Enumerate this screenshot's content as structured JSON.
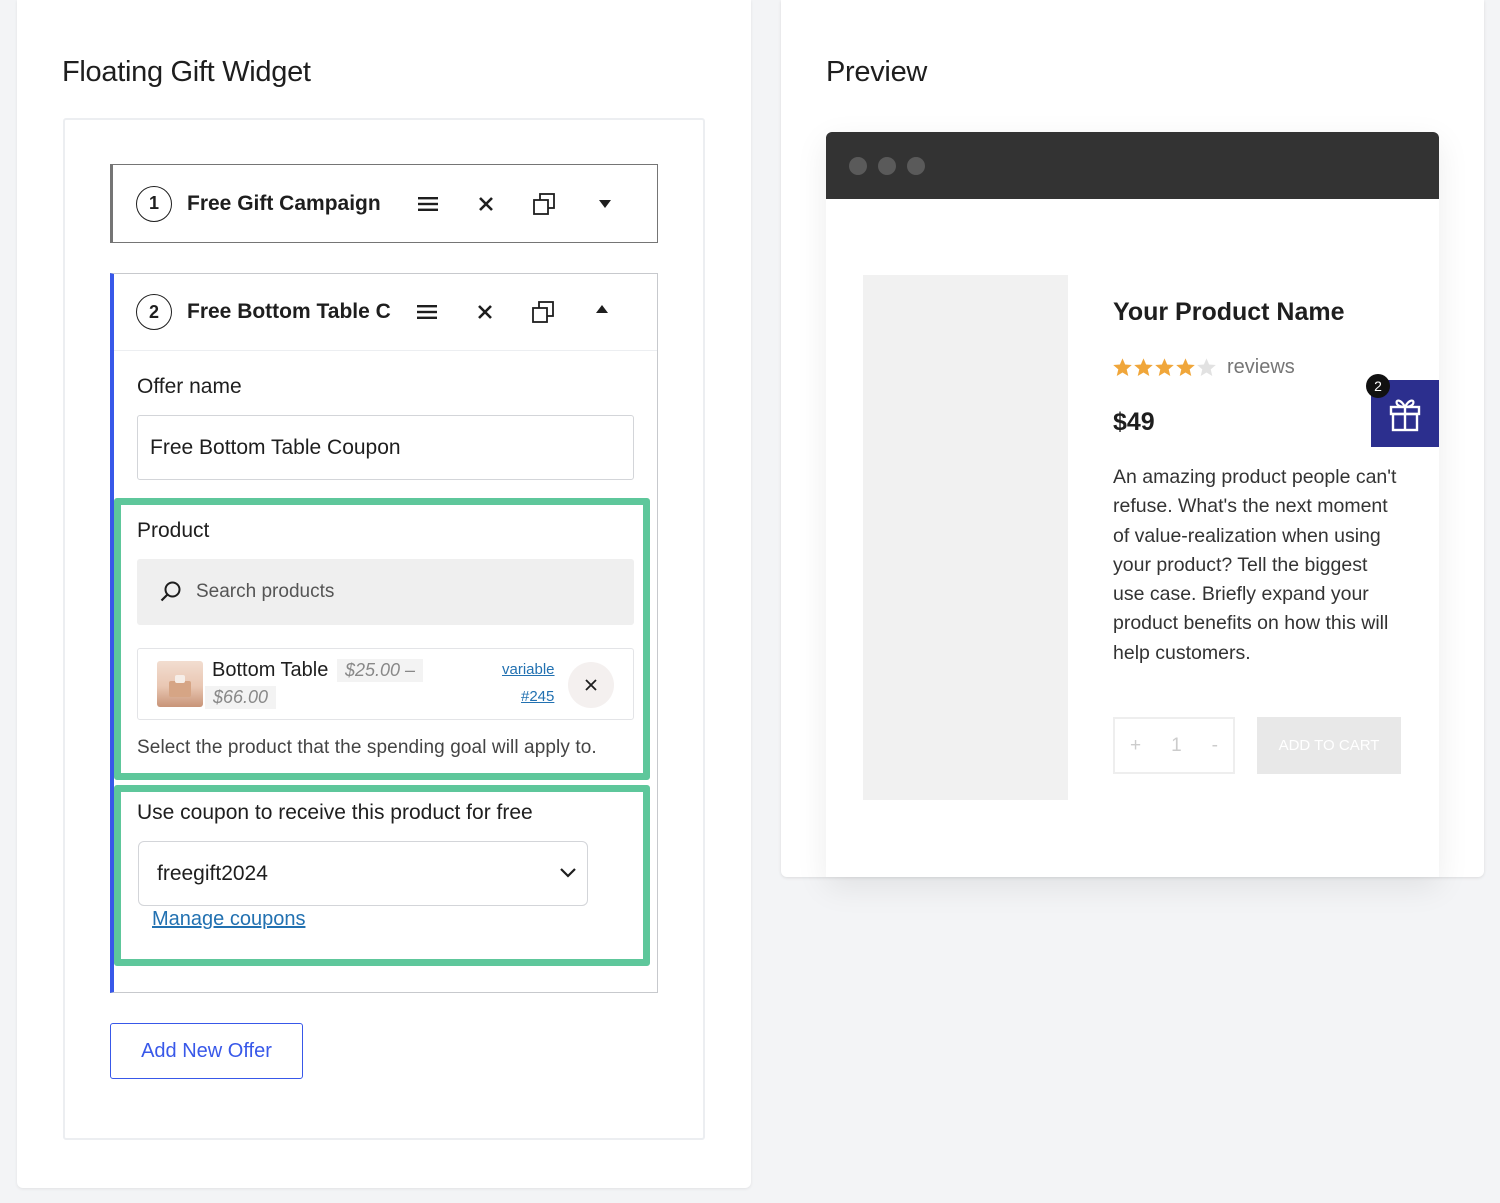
{
  "left_panel": {
    "title": "Floating Gift Widget"
  },
  "right_panel": {
    "title": "Preview"
  },
  "offers": [
    {
      "number": "1",
      "name": "Free Gift Campaign",
      "expanded": false
    },
    {
      "number": "2",
      "name": "Free Bottom Table C",
      "expanded": true
    }
  ],
  "offer_form": {
    "offer_name_label": "Offer name",
    "offer_name_value": "Free Bottom Table Coupon",
    "product_label": "Product",
    "search_placeholder": "Search products",
    "selected_product": {
      "name": "Bottom Table",
      "price_range_start": "$25.00 –",
      "price_range_end": "$66.00",
      "type": "variable",
      "id": "#245"
    },
    "product_help": "Select the product that the spending goal will apply to.",
    "coupon_label": "Use coupon to receive this product for free",
    "coupon_value": "freegift2024",
    "manage_coupons": "Manage coupons"
  },
  "add_offer_button": "Add New Offer",
  "preview": {
    "product_name": "Your Product Name",
    "rating": 4,
    "rating_max": 5,
    "reviews_label": "reviews",
    "price": "$49",
    "description": "An amazing product people can't refuse. What's the next moment of value-realization when using your product? Tell the biggest use case. Briefly expand your product benefits on how this will help customers.",
    "qty_plus": "+",
    "qty_value": "1",
    "qty_minus": "-",
    "add_to_cart": "ADD TO CART",
    "gift_badge_count": "2"
  },
  "colors": {
    "accent_blue": "#3858e9",
    "highlight_green": "#5ec79b",
    "gift_widget_bg": "#2c2f8e",
    "star_gold": "#f0a63a",
    "link_blue": "#2271b1"
  },
  "icons": [
    "drag-handle-icon",
    "close-icon",
    "duplicate-icon",
    "chevron-down-icon",
    "chevron-up-icon",
    "search-icon",
    "gift-icon",
    "star-icon"
  ]
}
